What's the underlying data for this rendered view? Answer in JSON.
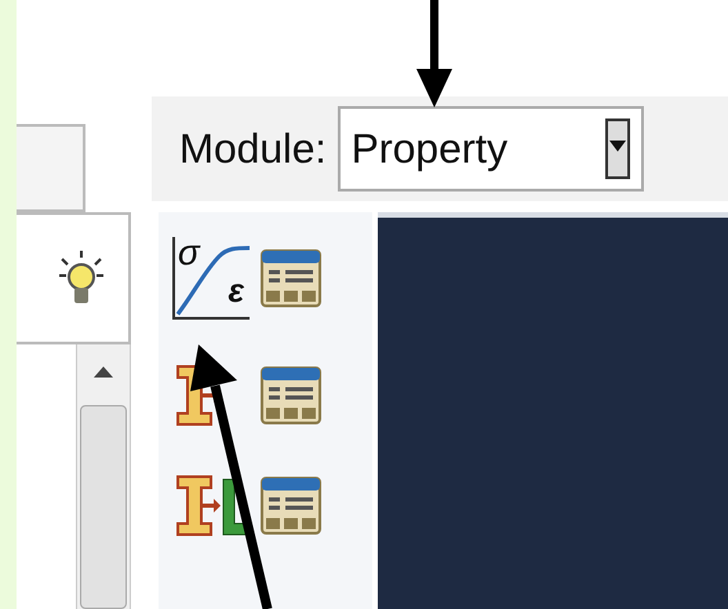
{
  "toolbar": {
    "module_label": "Module:",
    "module_combo": {
      "value": "Property"
    }
  },
  "toolbox": {
    "material_icon": {
      "stress": "σ",
      "strain": "ε"
    }
  }
}
